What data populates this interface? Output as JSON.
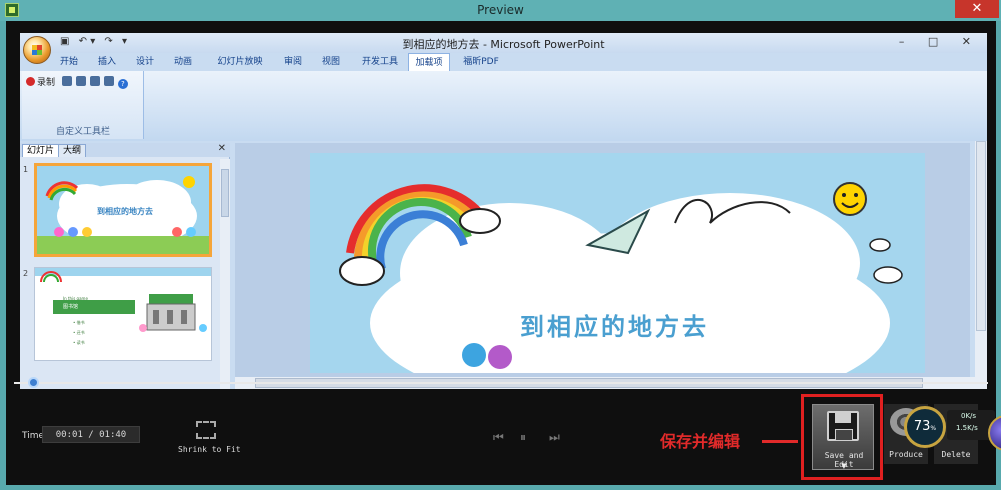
{
  "window": {
    "title": "Preview",
    "close_label": "✕"
  },
  "ppt": {
    "title": "到相应的地方去 - Microsoft PowerPoint",
    "qat": [
      "▣",
      "↶ ▾",
      "↷",
      "▾"
    ],
    "window_controls": "– □ ✕",
    "tabs": [
      "开始",
      "插入",
      "设计",
      "动画",
      "幻灯片放映",
      "审阅",
      "视图",
      "开发工具",
      "加载项",
      "福昕PDF"
    ],
    "active_tab": "加载项",
    "ribbon_group": {
      "label": "自定义工具栏",
      "record_label": "录制"
    },
    "pane_tabs": [
      "幻灯片",
      "大纲"
    ],
    "pane_close": "✕",
    "slides": [
      {
        "number": "1",
        "title": "到相应的地方去"
      },
      {
        "number": "2",
        "header": "In this game",
        "box": "图书馆",
        "items": [
          "借书",
          "还书",
          "读书"
        ]
      }
    ],
    "slide_title": "到相应的地方去"
  },
  "player": {
    "progress": 0.02,
    "time_label": "Time",
    "time_value": "00:01 / 01:40",
    "shrink_label": "Shrink to Fit",
    "prev": "⏮",
    "pause": "⏸",
    "next": "⏭"
  },
  "annotation": {
    "text": "保存并编辑",
    "color": "#e12a2a"
  },
  "actions": {
    "save_edit": "Save and Edit",
    "save_dropdown": "▼",
    "produce": "Produce",
    "delete": "Delete"
  },
  "monitor": {
    "cpu": "73",
    "cpu_unit": "%",
    "up": "0K/s",
    "down": "1.5K/s"
  },
  "colors": {
    "accent": "#3e7fd0",
    "title_text": "#4a9fd0",
    "highlight": "#f5a53a"
  }
}
